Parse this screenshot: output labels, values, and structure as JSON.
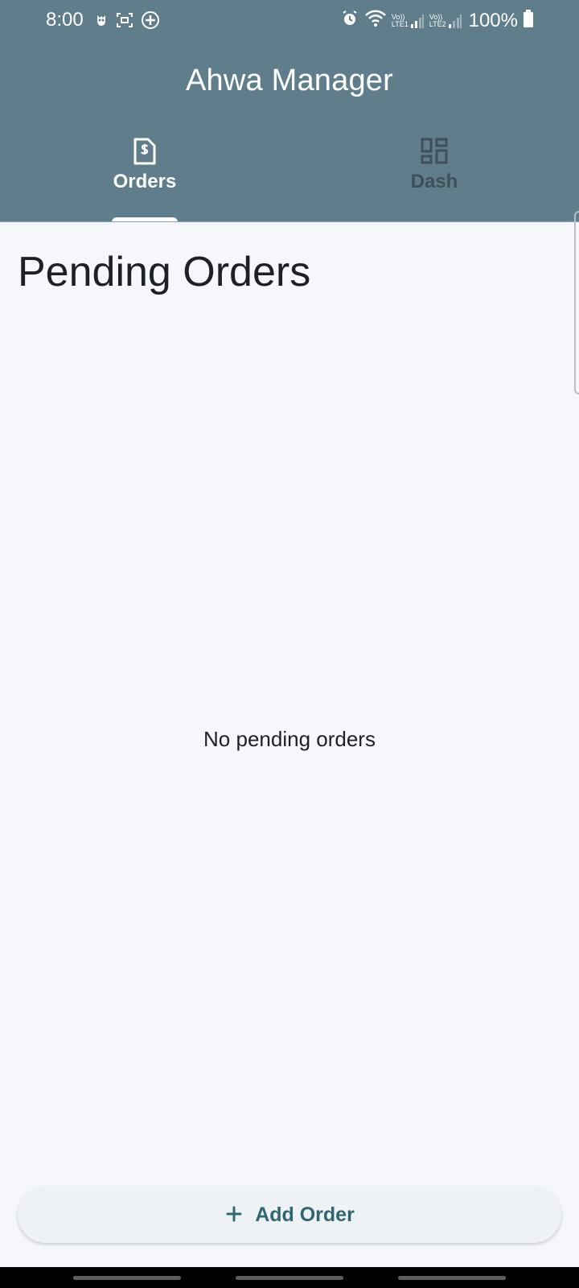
{
  "status_bar": {
    "time": "8:00",
    "battery": "100%",
    "left_icons": [
      "owl-icon",
      "screenshot-icon",
      "add-circle-icon"
    ],
    "right_icons": [
      "alarm-icon",
      "wifi-icon",
      "signal-lte1-icon",
      "signal-lte2-icon",
      "battery-icon"
    ],
    "sim1_label_top": "Vo))",
    "sim1_label_bottom": "LTE1",
    "sim2_label_top": "Vo))",
    "sim2_label_bottom": "LTE2"
  },
  "app_bar": {
    "title": "Ahwa Manager",
    "background_color": "#607d8b"
  },
  "tabs": [
    {
      "label": "Orders",
      "icon": "receipt-dollar-icon",
      "selected": true,
      "color": "#ffffff"
    },
    {
      "label": "Dash",
      "icon": "dashboard-icon",
      "selected": false,
      "color": "#3f4f58"
    }
  ],
  "main": {
    "title": "Pending Orders",
    "empty_message": "No pending orders"
  },
  "action": {
    "label": "Add Order",
    "icon": "plus-icon",
    "color": "#2f6670"
  }
}
